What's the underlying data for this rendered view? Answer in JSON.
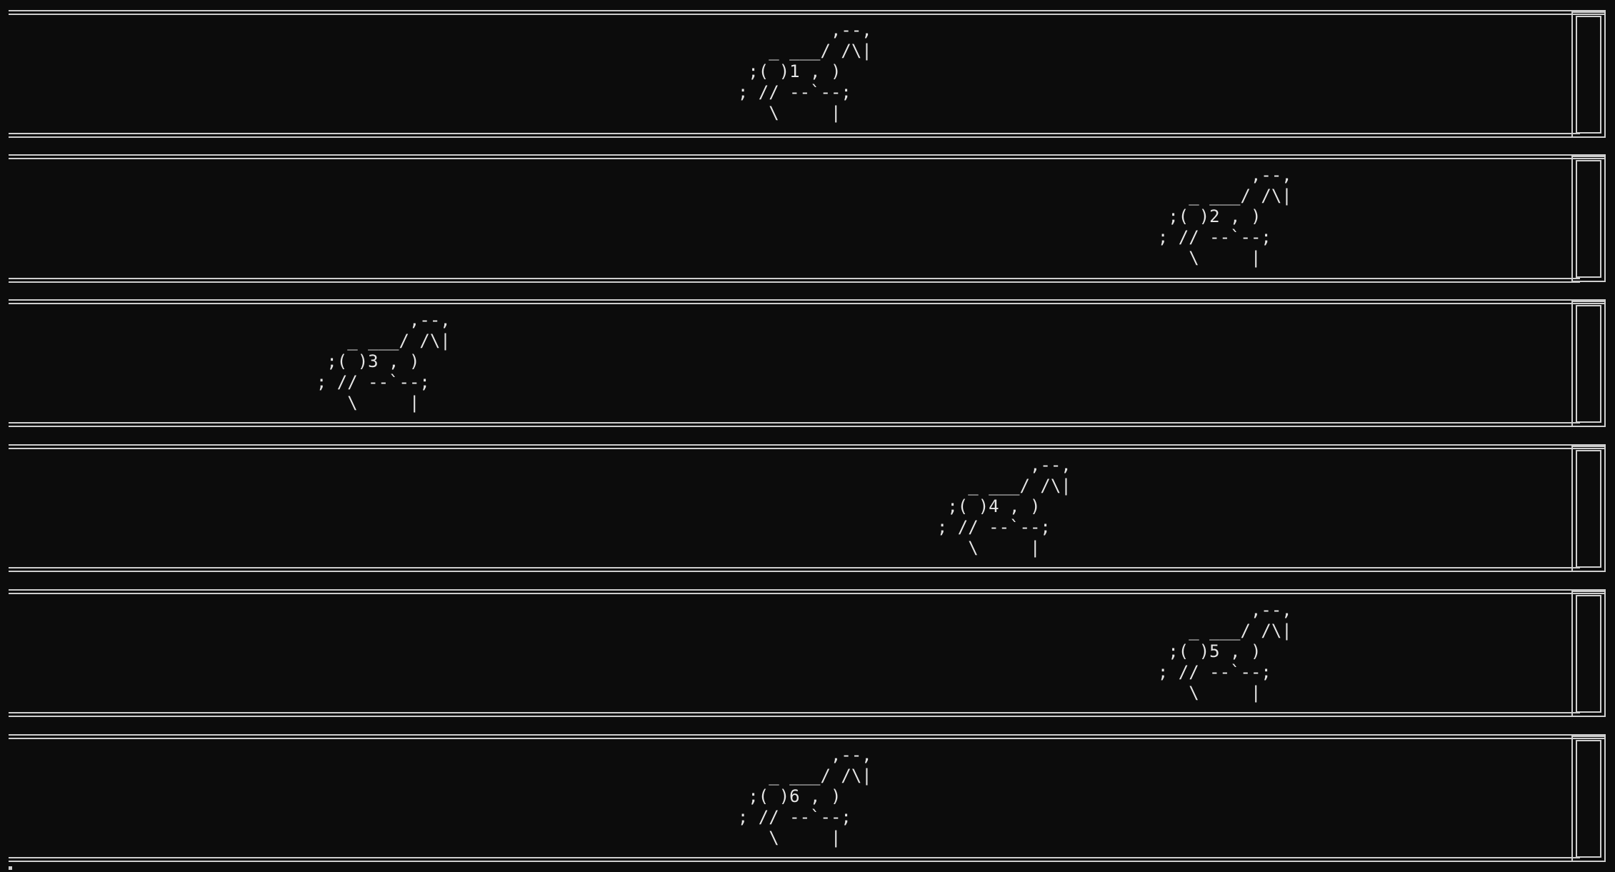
{
  "terminal": {
    "background": "#0c0c0c",
    "foreground": "#e6e6e6",
    "border_color": "#cfcfcf"
  },
  "race": {
    "lanes": [
      {
        "lane": 1,
        "horse_art": "           ,--,\n     _ ___/ /\\|\n   ;( )1 , )\n  ; // --`--;\n     \\     |"
      },
      {
        "lane": 2,
        "horse_art": "           ,--,\n     _ ___/ /\\|\n   ;( )2 , )\n  ; // --`--;\n     \\     |"
      },
      {
        "lane": 3,
        "horse_art": "           ,--,\n     _ ___/ /\\|\n   ;( )3 , )\n  ; // --`--;\n     \\     |"
      },
      {
        "lane": 4,
        "horse_art": "           ,--,\n     _ ___/ /\\|\n   ;( )4 , )\n  ; // --`--;\n     \\     |"
      },
      {
        "lane": 5,
        "horse_art": "           ,--,\n     _ ___/ /\\|\n   ;( )5 , )\n  ; // --`--;\n     \\     |"
      },
      {
        "lane": 6,
        "horse_art": "           ,--,\n     _ ___/ /\\|\n   ;( )6 , )\n  ; // --`--;\n     \\     |"
      }
    ]
  }
}
